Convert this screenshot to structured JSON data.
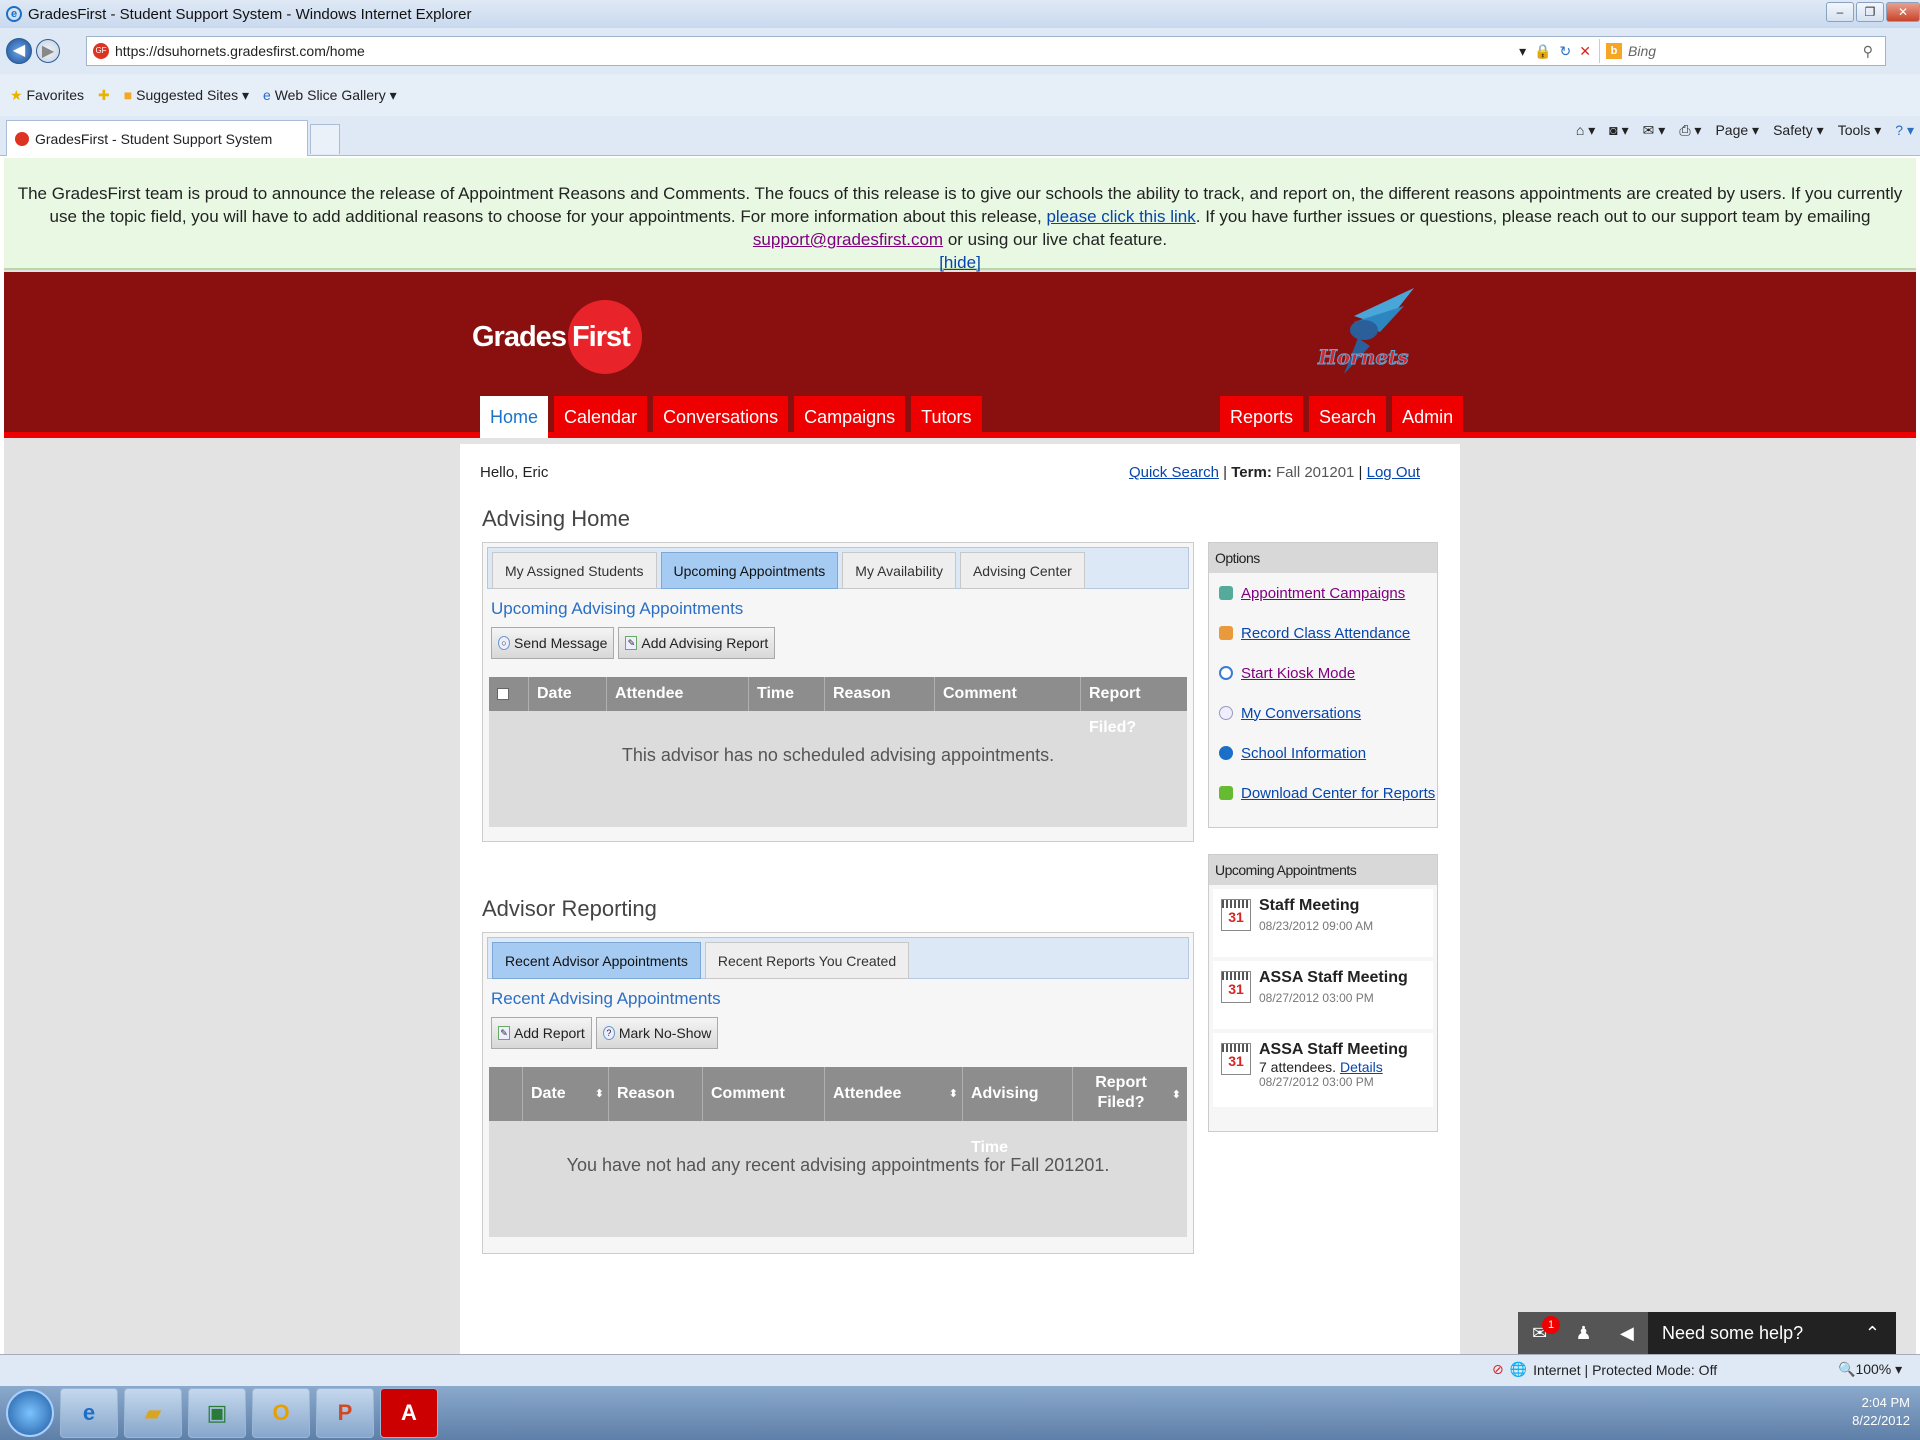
{
  "window": {
    "title": "GradesFirst - Student Support System - Windows Internet Explorer"
  },
  "address": {
    "url": "https://dsuhornets.gradesfirst.com/home",
    "search_placeholder": "Bing"
  },
  "favorites": {
    "favorites_label": "Favorites",
    "suggested_label": "Suggested Sites ▾",
    "webslice_label": "Web Slice Gallery ▾"
  },
  "browser_tab": {
    "label": "GradesFirst - Student Support System"
  },
  "command_bar": {
    "page": "Page ▾",
    "safety": "Safety ▾",
    "tools": "Tools ▾"
  },
  "announcement": {
    "text1": "The GradesFirst team is proud to announce the release of Appointment Reasons and Comments.  The foucs of this release is to give our schools the ability to track, and report on, the different reasons appointments are created by users.  If you currently use the topic field, you will have to add additional reasons to choose for your appointments.  For more information about this release, ",
    "link1": "please click this link",
    "text2": ".  If you have further issues or questions, please reach out to our support team by emailing ",
    "email": "support@gradesfirst.com",
    "text3": " or using our live chat feature.",
    "hide": "[hide]"
  },
  "logo": {
    "grades": "Grades",
    "first": "First"
  },
  "nav": {
    "left": [
      "Home",
      "Calendar",
      "Conversations",
      "Campaigns",
      "Tutors"
    ],
    "right": [
      "Reports",
      "Search",
      "Admin"
    ]
  },
  "topline": {
    "greeting": "Hello, Eric",
    "quick_search": "Quick Search",
    "term_label": "Term:",
    "term_value": "Fall 201201",
    "logout": "Log Out"
  },
  "advising": {
    "title": "Advising Home",
    "tabs": [
      "My Assigned Students",
      "Upcoming Appointments",
      "My Availability",
      "Advising Center"
    ],
    "section_title": "Upcoming Advising Appointments",
    "buttons": [
      "Send Message",
      "Add Advising Report"
    ],
    "columns": [
      "Date",
      "Attendee",
      "Time",
      "Reason",
      "Comment",
      "Report Filed?"
    ],
    "empty": "This advisor has no scheduled advising appointments."
  },
  "reporting": {
    "title": "Advisor Reporting",
    "tabs": [
      "Recent Advisor Appointments",
      "Recent Reports You Created"
    ],
    "section_title": "Recent Advising Appointments",
    "buttons": [
      "Add Report",
      "Mark No-Show"
    ],
    "columns": [
      "Date",
      "Reason",
      "Comment",
      "Attendee",
      "Advising Time",
      "Report Filed?"
    ],
    "empty": "You have not had any recent advising appointments for Fall 201201."
  },
  "options": {
    "title": "Options",
    "items": [
      "Appointment Campaigns",
      "Record Class Attendance",
      "Start Kiosk Mode",
      "My Conversations",
      "School Information",
      "Download Center for Reports"
    ]
  },
  "upcoming": {
    "title": "Upcoming Appointments",
    "cal_day": "31",
    "items": [
      {
        "title": "Staff Meeting",
        "date": "08/23/2012 09:00 AM"
      },
      {
        "title": "ASSA Staff Meeting",
        "date": "08/27/2012 03:00 PM"
      },
      {
        "title": "ASSA Staff Meeting",
        "attendees": "7 attendees.",
        "details": "Details",
        "date": "08/27/2012 03:00 PM"
      }
    ]
  },
  "help": {
    "label": "Need some help?",
    "badge": "1"
  },
  "status": {
    "zone": "Internet | Protected Mode: Off",
    "zoom": "100%"
  },
  "tray": {
    "time": "2:04 PM",
    "date": "8/22/2012"
  }
}
